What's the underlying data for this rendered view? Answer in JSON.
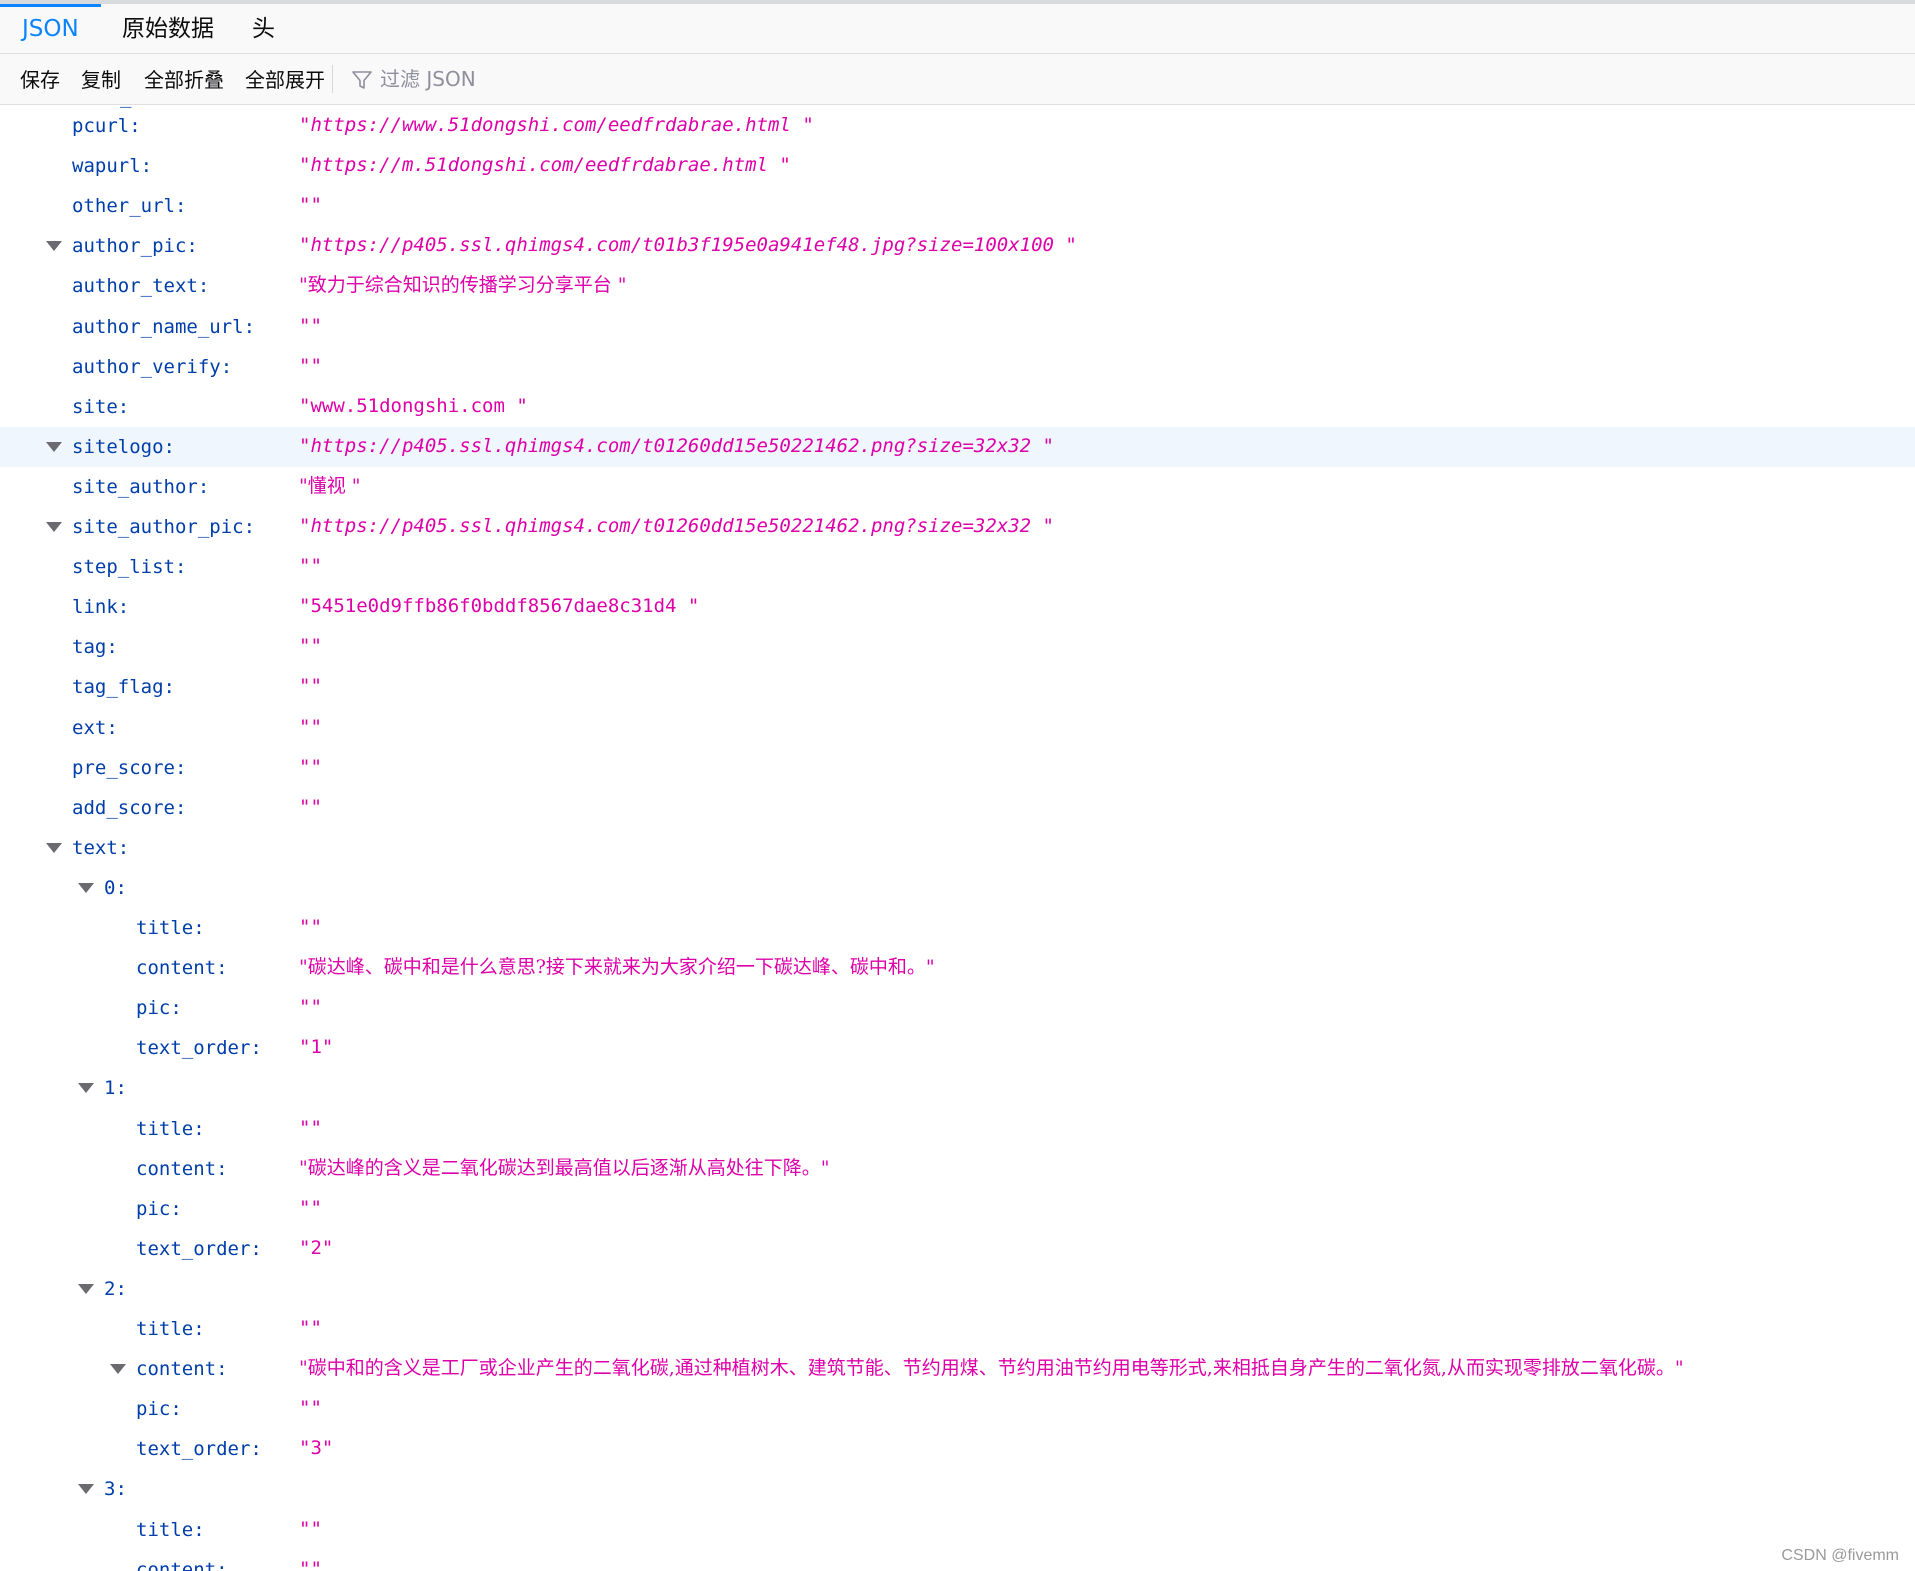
{
  "tabs": [
    {
      "label": "JSON",
      "active": true
    },
    {
      "label": "原始数据",
      "active": false
    },
    {
      "label": "头",
      "active": false
    }
  ],
  "toolbar": {
    "save": "保存",
    "copy": "复制",
    "collapse_all": "全部折叠",
    "expand_all": "全部展开",
    "filter_placeholder": "过滤 JSON"
  },
  "colors": {
    "accent": "#0a84ff",
    "key": "#003eaa",
    "string_value": "#dd00a9",
    "highlight_row": "#f0f6fd"
  },
  "rows": [
    {
      "key": "pcurl:",
      "value": "\"https://www.51dongshi.com/eedfrdabrae.html \"",
      "depth": 1,
      "twisty": false,
      "style": "italic"
    },
    {
      "key": "wapurl:",
      "value": "\"https://m.51dongshi.com/eedfrdabrae.html \"",
      "depth": 1,
      "twisty": false,
      "style": "italic"
    },
    {
      "key": "other_url:",
      "value": "\"\"",
      "depth": 1,
      "twisty": false,
      "style": ""
    },
    {
      "key": "author_pic:",
      "value": "\"https://p405.ssl.qhimgs4.com/t01b3f195e0a941ef48.jpg?size=100x100 \"",
      "depth": 1,
      "twisty": true,
      "style": "italic"
    },
    {
      "key": "author_text:",
      "value": "\"致力于综合知识的传播学习分享平台 \"",
      "depth": 1,
      "twisty": false,
      "style": "cjk"
    },
    {
      "key": "author_name_url:",
      "value": "\"\"",
      "depth": 1,
      "twisty": false,
      "style": ""
    },
    {
      "key": "author_verify:",
      "value": "\"\"",
      "depth": 1,
      "twisty": false,
      "style": ""
    },
    {
      "key": "site:",
      "value": "\"www.51dongshi.com \"",
      "depth": 1,
      "twisty": false,
      "style": ""
    },
    {
      "key": "sitelogo:",
      "value": "\"https://p405.ssl.qhimgs4.com/t01260dd15e50221462.png?size=32x32 \"",
      "depth": 1,
      "twisty": true,
      "style": "italic",
      "highlight": true
    },
    {
      "key": "site_author:",
      "value": "\"懂视 \"",
      "depth": 1,
      "twisty": false,
      "style": "cjk"
    },
    {
      "key": "site_author_pic:",
      "value": "\"https://p405.ssl.qhimgs4.com/t01260dd15e50221462.png?size=32x32 \"",
      "depth": 1,
      "twisty": true,
      "style": "italic"
    },
    {
      "key": "step_list:",
      "value": "\"\"",
      "depth": 1,
      "twisty": false,
      "style": ""
    },
    {
      "key": "link:",
      "value": "\"5451e0d9ffb86f0bddf8567dae8c31d4 \"",
      "depth": 1,
      "twisty": false,
      "style": ""
    },
    {
      "key": "tag:",
      "value": "\"\"",
      "depth": 1,
      "twisty": false,
      "style": ""
    },
    {
      "key": "tag_flag:",
      "value": "\"\"",
      "depth": 1,
      "twisty": false,
      "style": ""
    },
    {
      "key": "ext:",
      "value": "\"\"",
      "depth": 1,
      "twisty": false,
      "style": ""
    },
    {
      "key": "pre_score:",
      "value": "\"\"",
      "depth": 1,
      "twisty": false,
      "style": ""
    },
    {
      "key": "add_score:",
      "value": "\"\"",
      "depth": 1,
      "twisty": false,
      "style": ""
    },
    {
      "key": "text:",
      "value": "",
      "depth": 1,
      "twisty": true,
      "style": ""
    },
    {
      "key": "0:",
      "value": "",
      "depth": 2,
      "twisty": true,
      "style": ""
    },
    {
      "key": "title:",
      "value": "\"\"",
      "depth": 3,
      "twisty": false,
      "style": ""
    },
    {
      "key": "content:",
      "value": "\"碳达峰、碳中和是什么意思?接下来就来为大家介绍一下碳达峰、碳中和。\"",
      "depth": 3,
      "twisty": false,
      "style": "cjk"
    },
    {
      "key": "pic:",
      "value": "\"\"",
      "depth": 3,
      "twisty": false,
      "style": ""
    },
    {
      "key": "text_order:",
      "value": "\"1\"",
      "depth": 3,
      "twisty": false,
      "style": ""
    },
    {
      "key": "1:",
      "value": "",
      "depth": 2,
      "twisty": true,
      "style": ""
    },
    {
      "key": "title:",
      "value": "\"\"",
      "depth": 3,
      "twisty": false,
      "style": ""
    },
    {
      "key": "content:",
      "value": "\"碳达峰的含义是二氧化碳达到最高值以后逐渐从高处往下降。\"",
      "depth": 3,
      "twisty": false,
      "style": "cjk"
    },
    {
      "key": "pic:",
      "value": "\"\"",
      "depth": 3,
      "twisty": false,
      "style": ""
    },
    {
      "key": "text_order:",
      "value": "\"2\"",
      "depth": 3,
      "twisty": false,
      "style": ""
    },
    {
      "key": "2:",
      "value": "",
      "depth": 2,
      "twisty": true,
      "style": ""
    },
    {
      "key": "title:",
      "value": "\"\"",
      "depth": 3,
      "twisty": false,
      "style": ""
    },
    {
      "key": "content:",
      "value": "\"碳中和的含义是工厂或企业产生的二氧化碳,通过种植树木、建筑节能、节约用煤、节约用油节约用电等形式,来相抵自身产生的二氧化氮,从而实现零排放二氧化碳。\"",
      "depth": 3,
      "twisty": true,
      "style": "cjk"
    },
    {
      "key": "pic:",
      "value": "\"\"",
      "depth": 3,
      "twisty": false,
      "style": ""
    },
    {
      "key": "text_order:",
      "value": "\"3\"",
      "depth": 3,
      "twisty": false,
      "style": ""
    },
    {
      "key": "3:",
      "value": "",
      "depth": 2,
      "twisty": true,
      "style": ""
    },
    {
      "key": "title:",
      "value": "\"\"",
      "depth": 3,
      "twisty": false,
      "style": ""
    },
    {
      "key": "content:",
      "value": "\"\"",
      "depth": 3,
      "twisty": false,
      "style": ""
    }
  ],
  "watermark": "CSDN @fivemm"
}
